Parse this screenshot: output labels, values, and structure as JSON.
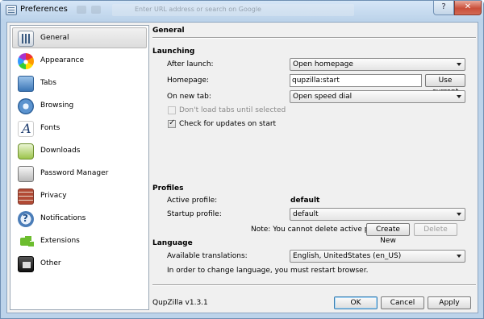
{
  "window": {
    "title": "Preferences",
    "help_label": "?",
    "close_label": "✕",
    "background_urlbar_placeholder": "Enter URL address or search on Google"
  },
  "sidebar": {
    "items": [
      {
        "label": "General",
        "icon": "general-icon",
        "selected": true
      },
      {
        "label": "Appearance",
        "icon": "appearance-icon"
      },
      {
        "label": "Tabs",
        "icon": "tabs-icon"
      },
      {
        "label": "Browsing",
        "icon": "browsing-icon"
      },
      {
        "label": "Fonts",
        "icon": "fonts-icon"
      },
      {
        "label": "Downloads",
        "icon": "downloads-icon"
      },
      {
        "label": "Password Manager",
        "icon": "password-icon"
      },
      {
        "label": "Privacy",
        "icon": "privacy-icon"
      },
      {
        "label": "Notifications",
        "icon": "notifications-icon"
      },
      {
        "label": "Extensions",
        "icon": "extensions-icon"
      },
      {
        "label": "Other",
        "icon": "other-icon"
      }
    ]
  },
  "page": {
    "title": "General",
    "launching": {
      "heading": "Launching",
      "after_launch_label": "After launch:",
      "after_launch_value": "Open homepage",
      "homepage_label": "Homepage:",
      "homepage_value": "qupzilla:start",
      "use_current_label": "Use current",
      "new_tab_label": "On new tab:",
      "new_tab_value": "Open speed dial",
      "dont_load_tabs_label": "Don't load tabs until selected",
      "dont_load_tabs_checked": false,
      "dont_load_tabs_enabled": false,
      "check_updates_label": "Check for updates on start",
      "check_updates_checked": true
    },
    "profiles": {
      "heading": "Profiles",
      "active_profile_label": "Active profile:",
      "active_profile_value": "default",
      "startup_profile_label": "Startup profile:",
      "startup_profile_value": "default",
      "note": "Note: You cannot delete active profile.",
      "create_new_label": "Create New",
      "delete_label": "Delete"
    },
    "language": {
      "heading": "Language",
      "translations_label": "Available translations:",
      "translations_value": "English, UnitedStates (en_US)",
      "restart_note": "In order to change language, you must restart browser."
    }
  },
  "footer": {
    "version": "QupZilla v1.3.1",
    "ok_label": "OK",
    "cancel_label": "Cancel",
    "apply_label": "Apply"
  },
  "colors": {
    "frame": "#bcd3ea",
    "dialog_bg": "#f0f0f0",
    "close_button": "#c94f3a",
    "default_button_border": "#3c7fb1"
  }
}
